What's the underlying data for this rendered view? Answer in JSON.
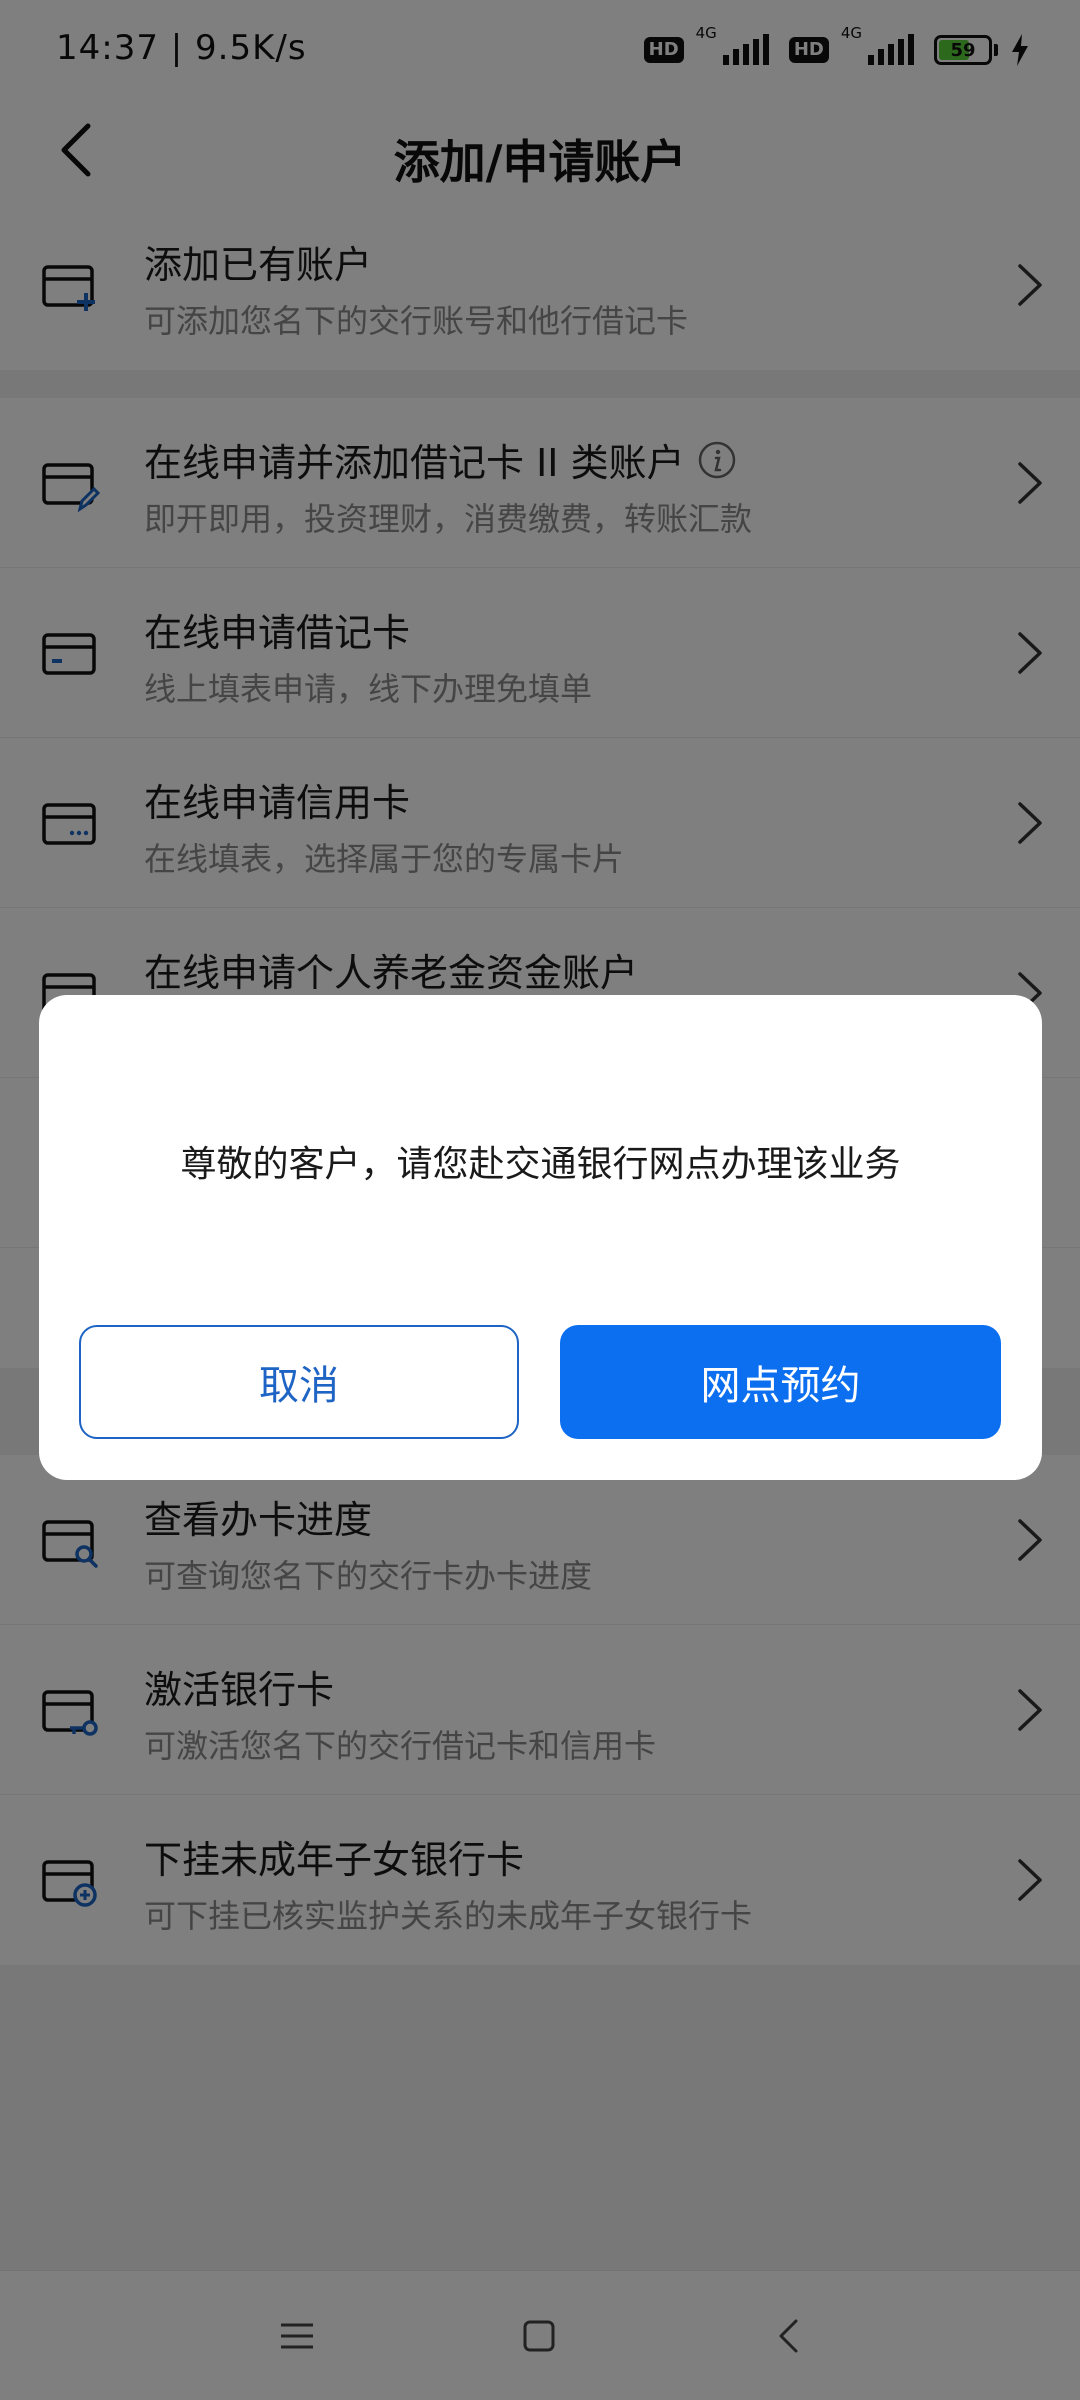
{
  "status_bar": {
    "time_speed": "14:37 | 9.5K/s",
    "hd1": "HD",
    "net1": "4G",
    "hd2": "HD",
    "net2": "4G",
    "battery_level": "59"
  },
  "header": {
    "title": "添加/申请账户"
  },
  "list": [
    {
      "title": "添加已有账户",
      "subtitle": "可添加您名下的交行账号和他行借记卡",
      "icon": "card-add-icon"
    },
    {
      "title": "在线申请并添加借记卡 II 类账户",
      "subtitle": "即开即用，投资理财，消费缴费，转账汇款",
      "icon": "card-edit-icon"
    },
    {
      "title": "在线申请借记卡",
      "subtitle": "线上填表申请，线下办理免填单",
      "icon": "debit-card-icon"
    },
    {
      "title": "在线申请信用卡",
      "subtitle": "在线填表，选择属于您的专属卡片",
      "icon": "credit-card-icon"
    },
    {
      "title": "在线申请个人养老金资金账户",
      "subtitle": "",
      "icon": "pension-card-icon"
    },
    {
      "title": "查看办卡进度",
      "subtitle": "可查询您名下的交行卡办卡进度",
      "icon": "card-search-icon"
    },
    {
      "title": "激活银行卡",
      "subtitle": "可激活您名下的交行借记卡和信用卡",
      "icon": "card-key-icon"
    },
    {
      "title": "下挂未成年子女银行卡",
      "subtitle": "可下挂已核实监护关系的未成年子女银行卡",
      "icon": "card-link-icon"
    }
  ],
  "dialog": {
    "message": "尊敬的客户，请您赴交通银行网点办理该业务",
    "cancel_label": "取消",
    "confirm_label": "网点预约"
  },
  "colors": {
    "accent": "#0c6ff0",
    "icon_blue": "#1d64c4",
    "battery_green": "#5ad338"
  }
}
